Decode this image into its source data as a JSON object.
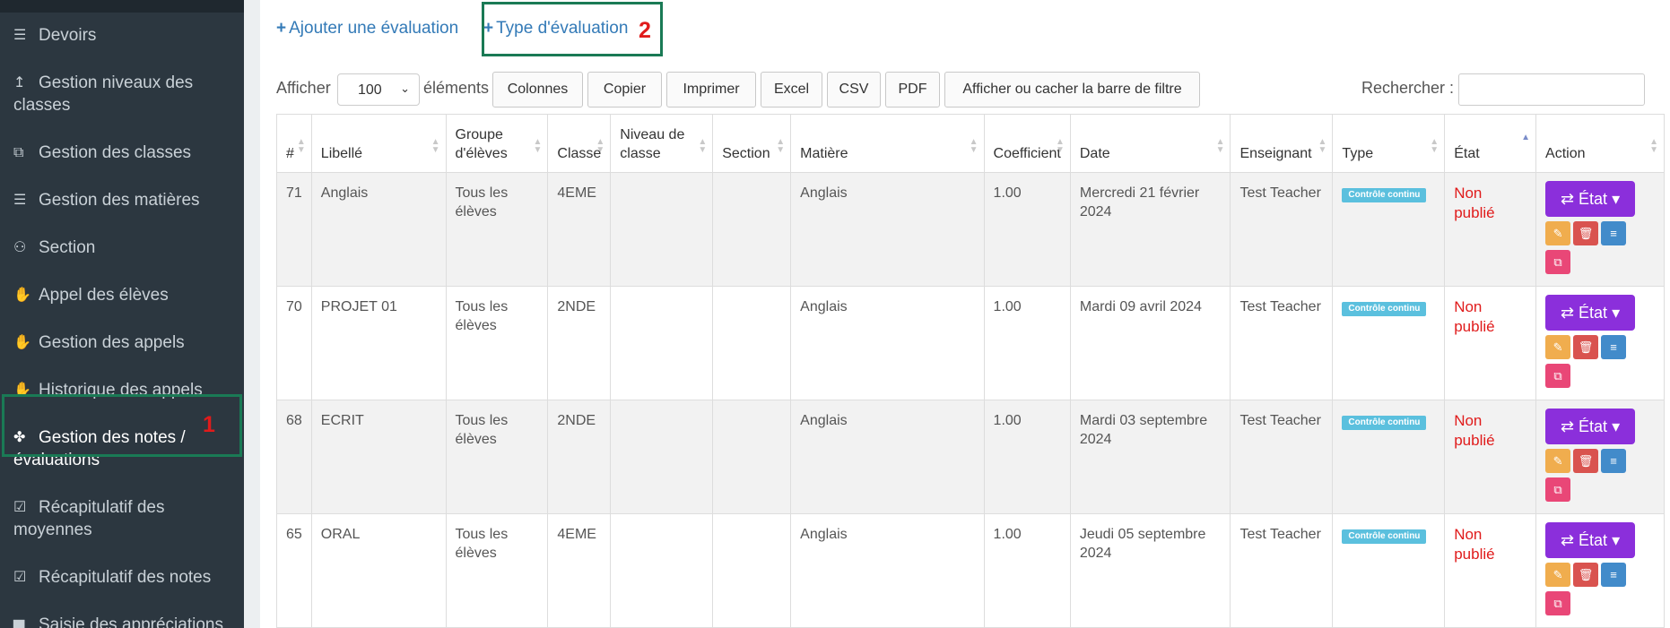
{
  "sidebar": {
    "items": [
      {
        "label": "Devoirs",
        "icon": "stack-icon",
        "glyph": "☰"
      },
      {
        "label": "Gestion niveaux des classes",
        "icon": "level-arrow-icon",
        "glyph": "↥"
      },
      {
        "label": "Gestion des classes",
        "icon": "sitemap-icon",
        "glyph": "⧉"
      },
      {
        "label": "Gestion des matières",
        "icon": "stack-icon",
        "glyph": "☰"
      },
      {
        "label": "Section",
        "icon": "users-icon",
        "glyph": "⚇"
      },
      {
        "label": "Appel des élèves",
        "icon": "hand-icon",
        "glyph": "✋"
      },
      {
        "label": "Gestion des appels",
        "icon": "hand-icon",
        "glyph": "✋"
      },
      {
        "label": "Historique des appels",
        "icon": "hand-icon",
        "glyph": "✋"
      },
      {
        "label": "Gestion des notes / évaluations",
        "icon": "puzzle-icon",
        "glyph": "✤"
      },
      {
        "label": "Récapitulatif des moyennes",
        "icon": "check-square-icon",
        "glyph": "☑"
      },
      {
        "label": "Récapitulatif des notes",
        "icon": "check-square-icon",
        "glyph": "☑"
      },
      {
        "label": "Saisie des appréciations",
        "icon": "file-icon",
        "glyph": "▆"
      }
    ],
    "annotation_1": "1"
  },
  "top_links": {
    "add_evaluation": "Ajouter une évaluation",
    "evaluation_type": "Type d'évaluation",
    "plus": "+",
    "annotation_2": "2"
  },
  "toolbar": {
    "show_label": "Afficher",
    "page_size": "100",
    "elements_label": "éléments",
    "buttons": [
      "Colonnes",
      "Copier",
      "Imprimer",
      "Excel",
      "CSV",
      "PDF",
      "Afficher ou cacher la barre de filtre"
    ],
    "search_label": "Rechercher :"
  },
  "table": {
    "headers": [
      "#",
      "Libellé",
      "Groupe d'élèves",
      "Classe",
      "Niveau de classe",
      "Section",
      "Matière",
      "Coefficient",
      "Date",
      "Enseignant",
      "Type",
      "État",
      "Action"
    ],
    "rows": [
      {
        "id": "71",
        "label": "Anglais",
        "group": "Tous les élèves",
        "classe": "4EME",
        "niveau": "",
        "section": "",
        "matiere": "Anglais",
        "coef": "1.00",
        "date": "Mercredi 21 février 2024",
        "teacher": "Test Teacher",
        "type": "Contrôle continu",
        "state": "Non publié",
        "action": "État"
      },
      {
        "id": "70",
        "label": "PROJET 01",
        "group": "Tous les élèves",
        "classe": "2NDE",
        "niveau": "",
        "section": "",
        "matiere": "Anglais",
        "coef": "1.00",
        "date": "Mardi 09 avril 2024",
        "teacher": "Test Teacher",
        "type": "Contrôle continu",
        "state": "Non publié",
        "action": "État"
      },
      {
        "id": "68",
        "label": "ECRIT",
        "group": "Tous les élèves",
        "classe": "2NDE",
        "niveau": "",
        "section": "",
        "matiere": "Anglais",
        "coef": "1.00",
        "date": "Mardi 03 septembre 2024",
        "teacher": "Test Teacher",
        "type": "Contrôle continu",
        "state": "Non publié",
        "action": "État"
      },
      {
        "id": "65",
        "label": "ORAL",
        "group": "Tous les élèves",
        "classe": "4EME",
        "niveau": "",
        "section": "",
        "matiere": "Anglais",
        "coef": "1.00",
        "date": "Jeudi 05 septembre 2024",
        "teacher": "Test Teacher",
        "type": "Contrôle continu",
        "state": "Non publié",
        "action": "État"
      }
    ]
  },
  "colors": {
    "sidebar_bg": "#2c3740",
    "link": "#337ab7",
    "highlight_box": "#1a7a55",
    "annotation": "#e01b1b",
    "action_button": "#8b2fdb",
    "type_badge": "#5bc0de",
    "state_unpublished": "#e01b1b"
  }
}
